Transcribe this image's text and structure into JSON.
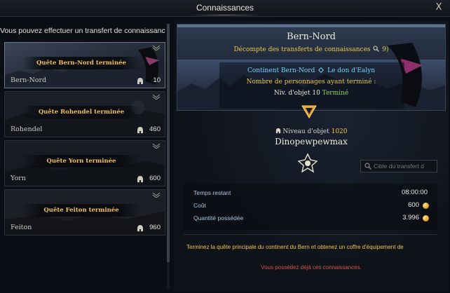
{
  "window": {
    "title": "Connaissances",
    "close_label": "X"
  },
  "left": {
    "header": "Vous pouvez effectuer un transfert de connaissances",
    "quests": [
      {
        "banner": "Quête Bern-Nord terminée",
        "name": "Bern-Nord",
        "count": "10",
        "selected": true
      },
      {
        "banner": "Quête Rohendel terminée",
        "name": "Rohendel",
        "count": "460",
        "selected": false
      },
      {
        "banner": "Quête Yorn terminée",
        "name": "Yorn",
        "count": "600",
        "selected": false
      },
      {
        "banner": "Quête Feiton terminée",
        "name": "Feiton",
        "count": "960",
        "selected": false
      }
    ]
  },
  "detail": {
    "continent": "Bern-Nord",
    "transfer_count": "Décompte des transferts de connaissances",
    "transfer_count_value": "9)",
    "reward_left": "Continent Bern-Nord",
    "reward_right": "Le don d'Ealyn",
    "completed_label": "Nombre de personnages ayant terminé :",
    "ilvl_prefix": "Niv. d'objet 10",
    "ilvl_status": "Terminé"
  },
  "target": {
    "ilvl_label": "Niveau d'objet",
    "ilvl_value": "1020",
    "name": "Dinopewpewmax",
    "search_placeholder": "Cible du transfert d"
  },
  "stats": {
    "time_label": "Temps restant",
    "time_value": "08:00:00",
    "cost_label": "Coût",
    "cost_value": "600",
    "owned_label": "Quantité possédée",
    "owned_value": "3.996"
  },
  "quest_info": "Terminez la quête principale du continent du Bern et obtenez un coffre d'équipement de",
  "warning": "Vous possédez déjà ces connaissances.",
  "colors": {
    "gold": "#f0c64a",
    "blue": "#6fd3ff",
    "green": "#8ad35a",
    "red": "#e05242"
  },
  "icons": [
    "close-icon",
    "chevron-down-icon",
    "helmet-icon",
    "search-icon",
    "gem-icon",
    "arrow-down-icon",
    "class-emblem-icon",
    "coin-icon"
  ]
}
